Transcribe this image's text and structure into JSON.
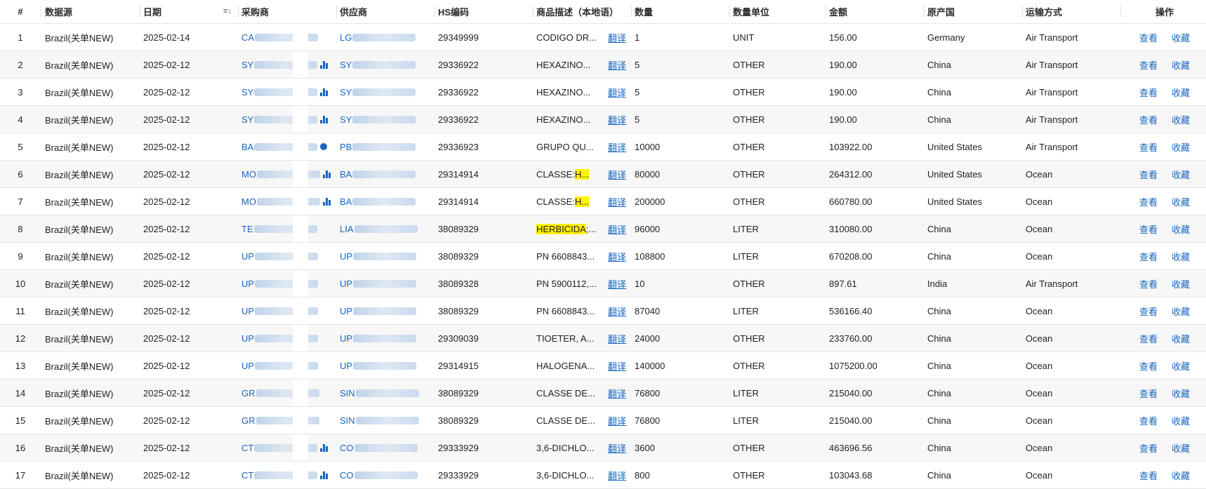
{
  "columns": {
    "num": "#",
    "source": "数据源",
    "date": "日期",
    "buyer": "采购商",
    "supplier": "供应商",
    "hs": "HS编码",
    "desc": "商品描述（本地语）",
    "qty": "数量",
    "unit": "数量单位",
    "amount": "金额",
    "origin": "原产国",
    "mode": "运输方式",
    "ops": "操作"
  },
  "labels": {
    "translate": "翻译",
    "view": "查看",
    "favorite": "收藏"
  },
  "sort_icon": "sort-descending-icon",
  "rows": [
    {
      "num": "1",
      "source": "Brazil(关单NEW)",
      "date": "2025-02-14",
      "buyer": "CA",
      "supplier": "LG",
      "hs": "29349999",
      "desc": "CODIGO DR...",
      "desc_hl": "",
      "qty": "1",
      "unit": "UNIT",
      "amount": "156.00",
      "origin": "Germany",
      "mode": "Air Transport"
    },
    {
      "num": "2",
      "source": "Brazil(关单NEW)",
      "date": "2025-02-12",
      "buyer": "SY",
      "supplier": "SY",
      "hs": "29336922",
      "desc": "HEXAZINO...",
      "desc_hl": "",
      "qty": "5",
      "unit": "OTHER",
      "amount": "190.00",
      "origin": "China",
      "mode": "Air Transport"
    },
    {
      "num": "3",
      "source": "Brazil(关单NEW)",
      "date": "2025-02-12",
      "buyer": "SY",
      "supplier": "SY",
      "hs": "29336922",
      "desc": "HEXAZINO...",
      "desc_hl": "",
      "qty": "5",
      "unit": "OTHER",
      "amount": "190.00",
      "origin": "China",
      "mode": "Air Transport"
    },
    {
      "num": "4",
      "source": "Brazil(关单NEW)",
      "date": "2025-02-12",
      "buyer": "SY",
      "supplier": "SY",
      "hs": "29336922",
      "desc": "HEXAZINO...",
      "desc_hl": "",
      "qty": "5",
      "unit": "OTHER",
      "amount": "190.00",
      "origin": "China",
      "mode": "Air Transport"
    },
    {
      "num": "5",
      "source": "Brazil(关单NEW)",
      "date": "2025-02-12",
      "buyer": "BA",
      "supplier": "PB",
      "hs": "29336923",
      "desc": "GRUPO QU...",
      "desc_hl": "",
      "qty": "10000",
      "unit": "OTHER",
      "amount": "103922.00",
      "origin": "United States",
      "mode": "Air Transport"
    },
    {
      "num": "6",
      "source": "Brazil(关单NEW)",
      "date": "2025-02-12",
      "buyer": "MO",
      "supplier": "BA",
      "hs": "29314914",
      "desc": "CLASSE: ",
      "desc_hl": "H...",
      "qty": "80000",
      "unit": "OTHER",
      "amount": "264312.00",
      "origin": "United States",
      "mode": "Ocean"
    },
    {
      "num": "7",
      "source": "Brazil(关单NEW)",
      "date": "2025-02-12",
      "buyer": "MO",
      "supplier": "BA",
      "hs": "29314914",
      "desc": "CLASSE: ",
      "desc_hl": "H...",
      "qty": "200000",
      "unit": "OTHER",
      "amount": "660780.00",
      "origin": "United States",
      "mode": "Ocean"
    },
    {
      "num": "8",
      "source": "Brazil(关单NEW)",
      "date": "2025-02-12",
      "buyer": "TE",
      "supplier": "LIA",
      "hs": "38089329",
      "desc": "",
      "desc_hl": "HERBICIDA",
      "desc_tail": ";...",
      "qty": "96000",
      "unit": "LITER",
      "amount": "310080.00",
      "origin": "China",
      "mode": "Ocean"
    },
    {
      "num": "9",
      "source": "Brazil(关单NEW)",
      "date": "2025-02-12",
      "buyer": "UP",
      "supplier": "UP",
      "hs": "38089329",
      "desc": "PN 6608843...",
      "desc_hl": "",
      "qty": "108800",
      "unit": "LITER",
      "amount": "670208.00",
      "origin": "China",
      "mode": "Ocean"
    },
    {
      "num": "10",
      "source": "Brazil(关单NEW)",
      "date": "2025-02-12",
      "buyer": "UP",
      "supplier": "UP",
      "hs": "38089328",
      "desc": "PN 5900112,...",
      "desc_hl": "",
      "qty": "10",
      "unit": "OTHER",
      "amount": "897.61",
      "origin": "India",
      "mode": "Air Transport"
    },
    {
      "num": "11",
      "source": "Brazil(关单NEW)",
      "date": "2025-02-12",
      "buyer": "UP",
      "supplier": "UP",
      "hs": "38089329",
      "desc": "PN 6608843...",
      "desc_hl": "",
      "qty": "87040",
      "unit": "LITER",
      "amount": "536166.40",
      "origin": "China",
      "mode": "Ocean"
    },
    {
      "num": "12",
      "source": "Brazil(关单NEW)",
      "date": "2025-02-12",
      "buyer": "UP",
      "supplier": "UP",
      "hs": "29309039",
      "desc": "TIOETER, A...",
      "desc_hl": "",
      "qty": "24000",
      "unit": "OTHER",
      "amount": "233760.00",
      "origin": "China",
      "mode": "Ocean"
    },
    {
      "num": "13",
      "source": "Brazil(关单NEW)",
      "date": "2025-02-12",
      "buyer": "UP",
      "supplier": "UP",
      "hs": "29314915",
      "desc": "HALOGENA...",
      "desc_hl": "",
      "qty": "140000",
      "unit": "OTHER",
      "amount": "1075200.00",
      "origin": "China",
      "mode": "Ocean"
    },
    {
      "num": "14",
      "source": "Brazil(关单NEW)",
      "date": "2025-02-12",
      "buyer": "GR",
      "supplier": "SIN",
      "hs": "38089329",
      "desc": "CLASSE DE...",
      "desc_hl": "",
      "qty": "76800",
      "unit": "LITER",
      "amount": "215040.00",
      "origin": "China",
      "mode": "Ocean"
    },
    {
      "num": "15",
      "source": "Brazil(关单NEW)",
      "date": "2025-02-12",
      "buyer": "GR",
      "supplier": "SIN",
      "hs": "38089329",
      "desc": "CLASSE DE...",
      "desc_hl": "",
      "qty": "76800",
      "unit": "LITER",
      "amount": "215040.00",
      "origin": "China",
      "mode": "Ocean"
    },
    {
      "num": "16",
      "source": "Brazil(关单NEW)",
      "date": "2025-02-12",
      "buyer": "CT",
      "supplier": "CO",
      "hs": "29333929",
      "desc": "3,6-DICHLO...",
      "desc_hl": "",
      "qty": "3600",
      "unit": "OTHER",
      "amount": "463696.56",
      "origin": "China",
      "mode": "Ocean"
    },
    {
      "num": "17",
      "source": "Brazil(关单NEW)",
      "date": "2025-02-12",
      "buyer": "CT",
      "supplier": "CO",
      "hs": "29333929",
      "desc": "3,6-DICHLO...",
      "desc_hl": "",
      "qty": "800",
      "unit": "OTHER",
      "amount": "103043.68",
      "origin": "China",
      "mode": "Ocean"
    }
  ]
}
